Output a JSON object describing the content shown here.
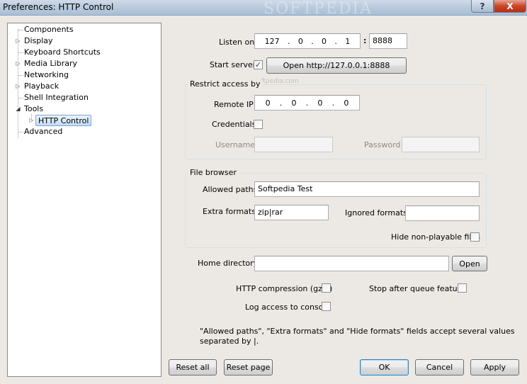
{
  "window": {
    "title": "Preferences: HTTP Control",
    "watermark": "SOFTPEDIA",
    "help_label": "?",
    "close_label": "X"
  },
  "tree": {
    "items": [
      {
        "label": "Components",
        "expander": ""
      },
      {
        "label": "Display",
        "expander": "▷"
      },
      {
        "label": "Keyboard Shortcuts",
        "expander": ""
      },
      {
        "label": "Media Library",
        "expander": "▷"
      },
      {
        "label": "Networking",
        "expander": ""
      },
      {
        "label": "Playback",
        "expander": "▷"
      },
      {
        "label": "Shell Integration",
        "expander": ""
      },
      {
        "label": "Tools",
        "expander": "◢"
      },
      {
        "label": "HTTP Control",
        "expander": "▷"
      },
      {
        "label": "Advanced",
        "expander": ""
      }
    ]
  },
  "server": {
    "listen_label": "Listen on",
    "ip": [
      "127",
      "0",
      "0",
      "1"
    ],
    "port_sep": ":",
    "port": "8888",
    "start_label": "Start server",
    "start_checked": "✓",
    "open_button": "Open http://127.0.0.1:8888",
    "watermark_text": "www.softpedia.com"
  },
  "restrict": {
    "title": "Restrict access by",
    "remote_ip_label": "Remote IP",
    "remote_ip": [
      "0",
      "0",
      "0",
      "0"
    ],
    "credentials_label": "Credentials",
    "username_label": "Username",
    "password_label": "Password",
    "username": "",
    "password": ""
  },
  "browser": {
    "title": "File browser",
    "allowed_paths_label": "Allowed paths",
    "allowed_paths": "Softpedia Test",
    "extra_formats_label": "Extra formats",
    "extra_formats": "zip|rar",
    "ignored_formats_label": "Ignored formats",
    "ignored_formats": "",
    "hide_label": "Hide non-playable files"
  },
  "home": {
    "label": "Home directory",
    "value": "",
    "open_button": "Open"
  },
  "options": {
    "compression_label": "HTTP compression (gzip)",
    "stop_queue_label": "Stop after queue feature",
    "log_label": "Log access to console"
  },
  "note": {
    "line1": "\"Allowed paths\", \"Extra formats\" and \"Hide formats\" fields accept several values",
    "line2": "separated by |."
  },
  "buttons": {
    "reset_all": "Reset all",
    "reset_page": "Reset page",
    "ok": "OK",
    "cancel": "Cancel",
    "apply": "Apply"
  }
}
